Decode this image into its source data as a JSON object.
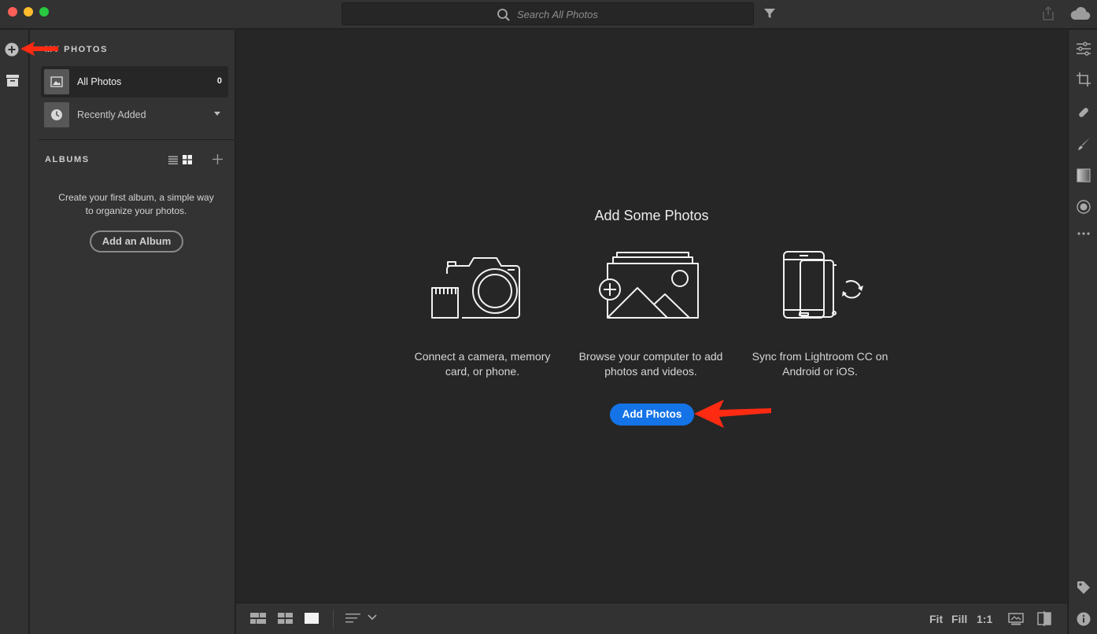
{
  "search": {
    "placeholder": "Search All Photos"
  },
  "sidebar": {
    "my_photos_heading": "MY PHOTOS",
    "items": [
      {
        "label": "All Photos",
        "count": "0"
      },
      {
        "label": "Recently Added"
      }
    ],
    "albums_heading": "ALBUMS",
    "albums_empty_text": "Create your first album, a simple way to organize your photos.",
    "add_album_label": "Add an Album"
  },
  "main": {
    "title": "Add Some Photos",
    "options": [
      {
        "icon": "camera-icon",
        "text": "Connect a camera, memory card, or phone."
      },
      {
        "icon": "add-photo-icon",
        "text": "Browse your computer to add photos and videos."
      },
      {
        "icon": "mobile-sync-icon",
        "text": "Sync from Lightroom CC on Android or iOS."
      }
    ],
    "add_photos_label": "Add Photos"
  },
  "bottombar": {
    "zoom_options": [
      "Fit",
      "Fill",
      "1:1"
    ]
  },
  "colors": {
    "accent": "#1473e6",
    "annotation_arrow": "#ff2a12"
  }
}
